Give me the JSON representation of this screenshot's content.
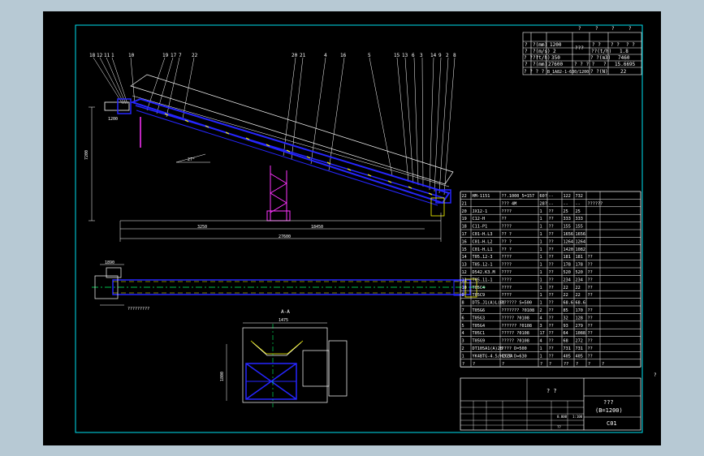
{
  "colors": {
    "background": "#b7c9d4",
    "canvas": "#000000",
    "frame": "#00e0f0",
    "drawing": "#ffffff",
    "structure": "#2626ff",
    "support": "#ff33ff",
    "rollers": "#ffff00",
    "centerline": "#00ff66"
  },
  "top_notes": [
    "?",
    "?",
    "?",
    "?"
  ],
  "spec_table": {
    "rows": [
      [
        "?",
        "?(mm)",
        "1200",
        "???",
        "? ?",
        "? ?",
        "? ?"
      ],
      [
        "?",
        "?(m/s)",
        "2",
        "",
        "??(t/h)",
        "1.8",
        ""
      ],
      [
        "? ? ?",
        "?(t/h)",
        "350",
        "",
        "? ?(m3)",
        "7460",
        ""
      ],
      [
        "?",
        "?(mm)",
        "27600",
        "",
        "? ? ? ?",
        "?",
        "15.6695"
      ],
      [
        "? ? ? ?",
        "B_1A82-1-630/1200",
        "",
        "? ?(N)",
        "",
        "22",
        ""
      ]
    ]
  },
  "callouts_left": [
    "18",
    "12",
    "11",
    "1",
    "10",
    "19",
    "17",
    "7",
    "22"
  ],
  "callouts_mid": [
    "20",
    "21",
    "4",
    "16",
    "5"
  ],
  "callouts_right": [
    "15",
    "13",
    "6",
    "3",
    "14",
    "9",
    "2",
    "8"
  ],
  "dimensions": {
    "overall_length": "27600",
    "segment_1": "3250",
    "segment_2": "18450",
    "incline": "27°",
    "head_height": "7200",
    "tail_offset": "1200",
    "plan_width": "1890",
    "section_width": "1475",
    "section_height": "1800"
  },
  "section_label": "A-A",
  "plan_note": "?????????",
  "parts": [
    {
      "no": "22",
      "code": "HM-1151",
      "name": "??.1000_5=157",
      "qty": "60?",
      "m1": "--",
      "m2": "122",
      "total": "732",
      "note": ""
    },
    {
      "no": "21",
      "code": "",
      "name": "??? 4M",
      "qty": "28?",
      "m1": "--",
      "m2": "--",
      "total": "--",
      "note": "??????"
    },
    {
      "no": "20",
      "code": "JX12-1",
      "name": "????",
      "qty": "1",
      "m1": "??",
      "m2": "25",
      "total": "25",
      "note": ""
    },
    {
      "no": "19",
      "code": "C12-H",
      "name": "??",
      "qty": "1",
      "m1": "??",
      "m2": "333",
      "total": "333",
      "note": ""
    },
    {
      "no": "18",
      "code": "C11-P1",
      "name": "????",
      "qty": "1",
      "m1": "??",
      "m2": "155",
      "total": "155",
      "note": ""
    },
    {
      "no": "17",
      "code": "C01-H.L3",
      "name": "?? ?",
      "qty": "1",
      "m1": "??",
      "m2": "1656",
      "total": "1656",
      "note": ""
    },
    {
      "no": "16",
      "code": "C01-H.L2",
      "name": "?? ?",
      "qty": "1",
      "m1": "??",
      "m2": "1264",
      "total": "1264",
      "note": ""
    },
    {
      "no": "15",
      "code": "C01-H.L1",
      "name": "?? ?",
      "qty": "1",
      "m1": "??",
      "m2": "1420",
      "total": "1082",
      "note": ""
    },
    {
      "no": "14",
      "code": "T05.12-3",
      "name": "????",
      "qty": "1",
      "m1": "??",
      "m2": "181",
      "total": "181",
      "note": "??"
    },
    {
      "no": "13",
      "code": "T05.12-1",
      "name": "????",
      "qty": "1",
      "m1": "??",
      "m2": "178",
      "total": "178",
      "note": "??"
    },
    {
      "no": "12",
      "code": "D542.K3.M",
      "name": "????",
      "qty": "1",
      "m1": "??",
      "m2": "520",
      "total": "520",
      "note": "??"
    },
    {
      "no": "11",
      "code": "T05.11-1",
      "name": "????",
      "qty": "1",
      "m1": "??",
      "m2": "234",
      "total": "234",
      "note": "??"
    },
    {
      "no": "10",
      "code": "T05C4",
      "name": "????",
      "qty": "1",
      "m1": "??",
      "m2": "22",
      "total": "22",
      "note": "??"
    },
    {
      "no": "9",
      "code": "T05C9",
      "name": "????",
      "qty": "1",
      "m1": "??",
      "m2": "22",
      "total": "22",
      "note": "??"
    },
    {
      "no": "8",
      "code": "DT5.J1(A)L(B)",
      "name": "?????? S=500",
      "qty": "1",
      "m1": "??",
      "m2": "68.6",
      "total": "68.6",
      "note": ""
    },
    {
      "no": "7",
      "code": "T05G6",
      "name": "??????? ?0108",
      "qty": "2",
      "m1": "??",
      "m2": "85",
      "total": "170",
      "note": "??"
    },
    {
      "no": "6",
      "code": "T05G3",
      "name": "????? ?0108",
      "qty": "4",
      "m1": "??",
      "m2": "32",
      "total": "128",
      "note": "??"
    },
    {
      "no": "5",
      "code": "T05G4",
      "name": "?????? ?0108",
      "qty": "3",
      "m1": "??",
      "m2": "93",
      "total": "279",
      "note": "??"
    },
    {
      "no": "4",
      "code": "T05C1",
      "name": "????? ?0108",
      "qty": "17",
      "m1": "??",
      "m2": "64",
      "total": "1088",
      "note": "??"
    },
    {
      "no": "3",
      "code": "T05G9",
      "name": "????? ?0108",
      "qty": "4",
      "m1": "??",
      "m2": "68",
      "total": "272",
      "note": "??"
    },
    {
      "no": "2",
      "code": "DT105A1(A)2B",
      "name": "???? D=500",
      "qty": "1",
      "m1": "??",
      "m2": "731",
      "total": "731",
      "note": "??"
    },
    {
      "no": "1",
      "code": "YK4BTG-4.5/H2G3A",
      "name": "???? D=630",
      "qty": "1",
      "m1": "??",
      "m2": "405",
      "total": "405",
      "note": "??"
    }
  ],
  "parts_header": [
    "?",
    "?",
    "?",
    "?",
    "?",
    "??",
    "?",
    "?",
    "?"
  ],
  "title_block": {
    "mid_text": "? ?",
    "title": "???",
    "subtitle": "(B=1200)",
    "drawing_no": "C01",
    "small_labels": [
      "0.000",
      "1:100",
      "??"
    ]
  },
  "right_margin_mark": "?"
}
